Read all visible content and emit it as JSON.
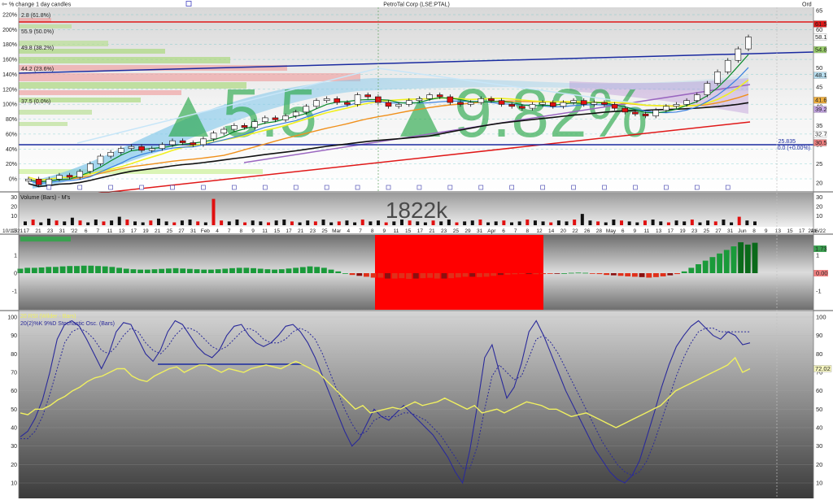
{
  "header": {
    "caption": "% change 1 day candles",
    "title": "PetroTal Corp (LSE:PTAL)",
    "right_label": "Ord",
    "big_change_left": "▲5.5",
    "big_change_right": "▲9.82%"
  },
  "colors": {
    "up_candle": "#ffffff",
    "down_candle": "#e01010",
    "ma_yellow": "#f0f020",
    "ma_orange": "#f0901c",
    "ma_black": "#101010",
    "ma_green": "#0a8a2a",
    "ma_blue": "#3a80e0",
    "trend_red": "#e01818",
    "trend_purple": "#9a66c0",
    "trend_navy": "#1a2aa0",
    "volume_up": "#101010",
    "volume_down": "#e01010",
    "macd_pos": "#1a9a3a",
    "macd_neg": "#e0301a",
    "rsi": "#f0f060",
    "stoch": "#2a2a9a"
  },
  "price_panel": {
    "left_pct_ticks": [
      "220%",
      "200%",
      "180%",
      "160%",
      "140%",
      "120%",
      "100%",
      "80%",
      "60%",
      "40%",
      "20%",
      "0%"
    ],
    "right_price_ticks": [
      "65",
      "60",
      "55",
      "50",
      "45",
      "40",
      "35",
      "30",
      "25",
      "20"
    ],
    "fib_labels": [
      "2.8 (61.8%)",
      "55.9 (50.0%)",
      "49.8 (38.2%)",
      "44.2 (23.6%)",
      "37.5 (0.0%)"
    ],
    "price_boxes": [
      {
        "label": "61.5",
        "color": "#e01818"
      },
      {
        "label": "58.1",
        "color": "#ffffff"
      },
      {
        "label": "54.8",
        "color": "#9ad06a"
      },
      {
        "label": "48.1",
        "color": "#b8dff0"
      },
      {
        "label": "41.6",
        "color": "#f0b040"
      },
      {
        "label": "39.2",
        "color": "#c8a8e8"
      },
      {
        "label": "32.7",
        "color": "#ffffff"
      },
      {
        "label": "30.5",
        "color": "#f08080"
      }
    ],
    "support_value": "25.835",
    "support_change": "0.0  (+0.00%)",
    "close_series": [
      21,
      19.5,
      21,
      22,
      21.5,
      23,
      25,
      27,
      28,
      29,
      29.5,
      28.5,
      29,
      30,
      31,
      30.5,
      30,
      31.5,
      33,
      34,
      35,
      34.5,
      36,
      37,
      36.5,
      37.5,
      38.5,
      40,
      41.5,
      42,
      41,
      40.5,
      43,
      42.5,
      41,
      40,
      40.5,
      41.5,
      42,
      43,
      42.5,
      41,
      40.5,
      41,
      42,
      41.5,
      40.5,
      40,
      39.5,
      40.5,
      41,
      40,
      41,
      41.5,
      40.5,
      41,
      40.5,
      39.5,
      38.5,
      38,
      37.5,
      39,
      40,
      40.5,
      41.5,
      43,
      46,
      49,
      52,
      55,
      58.1
    ]
  },
  "volume_panel": {
    "label": "Volume (Bars) - M's",
    "big_value": "1822k",
    "left_ticks": [
      "30",
      "20",
      "10"
    ],
    "right_ticks": [
      "30",
      "20",
      "10"
    ],
    "date_labels": [
      "10/12/21",
      "15",
      "17",
      "21",
      "23",
      "31",
      "'22",
      "6",
      "7",
      "11",
      "13",
      "17",
      "19",
      "21",
      "25",
      "27",
      "31",
      "Feb",
      "4",
      "7",
      "8",
      "9",
      "11",
      "15",
      "17",
      "21",
      "23",
      "25",
      "Mar",
      "4",
      "7",
      "8",
      "9",
      "11",
      "15",
      "17",
      "21",
      "23",
      "25",
      "29",
      "31",
      "Apr",
      "6",
      "7",
      "8",
      "12",
      "14",
      "20",
      "22",
      "26",
      "28",
      "May",
      "6",
      "9",
      "11",
      "13",
      "17",
      "19",
      "23",
      "25",
      "27",
      "31",
      "Jun",
      "8",
      "9",
      "13",
      "15",
      "17",
      "21",
      "24/6/22"
    ],
    "values": [
      4,
      6,
      3,
      7,
      5,
      4,
      8,
      5,
      3,
      6,
      4,
      5,
      9,
      6,
      4,
      3,
      5,
      7,
      4,
      3,
      5,
      6,
      4,
      3,
      28,
      5,
      4,
      6,
      3,
      5,
      4,
      3,
      5,
      6,
      4,
      3,
      5,
      4,
      6,
      3,
      4,
      5,
      3,
      6,
      4,
      5,
      3,
      4,
      6,
      5,
      4,
      3,
      5,
      4,
      6,
      3,
      4,
      5,
      6,
      3,
      4,
      5,
      3,
      4,
      6,
      5,
      4,
      3,
      5,
      4,
      6,
      12,
      5,
      4,
      3,
      6,
      5,
      4,
      3,
      5,
      6,
      4,
      3,
      5,
      4,
      6,
      3,
      5,
      4,
      6,
      3,
      9,
      5,
      4
    ]
  },
  "macd_panel": {
    "left_ticks": [
      "1",
      "0",
      "-1"
    ],
    "right_ticks": [
      "1",
      "0.00",
      "-1"
    ],
    "last_value": "1.73",
    "values": [
      0.25,
      0.3,
      0.3,
      0.32,
      0.35,
      0.35,
      0.38,
      0.4,
      0.4,
      0.42,
      0.42,
      0.4,
      0.38,
      0.35,
      0.3,
      0.25,
      0.22,
      0.2,
      0.2,
      0.22,
      0.24,
      0.26,
      0.28,
      0.26,
      0.24,
      0.22,
      0.2,
      0.2,
      0.22,
      0.25,
      0.28,
      0.3,
      0.3,
      0.28,
      0.25,
      0.22,
      0.2,
      0.22,
      0.26,
      0.3,
      0.34,
      0.38,
      0.35,
      0.3,
      0.2,
      0.1,
      0,
      -0.1,
      -0.15,
      -0.2,
      -0.25,
      -0.25,
      -0.3,
      -0.3,
      -0.28,
      -0.32,
      -0.3,
      -0.28,
      -0.26,
      -0.3,
      -0.3,
      -0.28,
      -0.24,
      -0.2,
      -0.2,
      -0.22,
      -0.2,
      -0.15,
      -0.1,
      -0.08,
      -0.06,
      -0.04,
      -0.05,
      -0.06,
      -0.05,
      -0.03,
      -0.02,
      0,
      0.02,
      0.03,
      0.02,
      -0.01,
      -0.05,
      -0.1,
      -0.12,
      -0.15,
      -0.18,
      -0.2,
      -0.22,
      -0.25,
      -0.22,
      -0.18,
      -0.12,
      -0.05,
      0.1,
      0.3,
      0.5,
      0.7,
      0.9,
      1.1,
      1.3,
      1.5,
      1.73,
      1.6,
      1.7
    ]
  },
  "osc_panel": {
    "rsi_label": "20 RSI (Wilder - Bars)",
    "stoch_label": "20(2)%K 9%D Stochastic Osc. (Bars)",
    "left_ticks": [
      "100",
      "90",
      "80",
      "70",
      "60",
      "50",
      "40",
      "30",
      "20",
      "10"
    ],
    "right_ticks": [
      "100",
      "90",
      "80",
      "70",
      "60",
      "50",
      "40",
      "30",
      "20",
      "10"
    ],
    "rsi_last": "72.02",
    "rsi": [
      48,
      47,
      50,
      50,
      52,
      55,
      57,
      60,
      62,
      65,
      67,
      68,
      70,
      72,
      72,
      68,
      66,
      65,
      68,
      70,
      72,
      73,
      70,
      72,
      74,
      74,
      72,
      70,
      72,
      71,
      70,
      72,
      73,
      74,
      73,
      72,
      74,
      76,
      74,
      72,
      70,
      66,
      62,
      58,
      54,
      50,
      52,
      48,
      49,
      50,
      51,
      50,
      52,
      54,
      52,
      53,
      54,
      56,
      54,
      52,
      50,
      52,
      48,
      49,
      50,
      48,
      50,
      52,
      54,
      53,
      52,
      50,
      50,
      48,
      46,
      47,
      48,
      46,
      44,
      42,
      40,
      42,
      44,
      46,
      48,
      50,
      52,
      56,
      60,
      62,
      64,
      66,
      68,
      70,
      72,
      74,
      78,
      70,
      72
    ],
    "stoch_k": [
      35,
      38,
      45,
      55,
      70,
      88,
      96,
      98,
      95,
      88,
      80,
      72,
      80,
      92,
      97,
      96,
      88,
      80,
      76,
      82,
      92,
      98,
      96,
      90,
      84,
      80,
      78,
      82,
      90,
      95,
      96,
      90,
      86,
      84,
      86,
      90,
      95,
      96,
      92,
      86,
      78,
      68,
      58,
      48,
      38,
      30,
      34,
      42,
      50,
      46,
      44,
      48,
      52,
      48,
      44,
      40,
      36,
      30,
      24,
      16,
      10,
      28,
      52,
      78,
      85,
      70,
      56,
      62,
      75,
      92,
      98,
      90,
      80,
      70,
      60,
      52,
      44,
      36,
      28,
      22,
      16,
      12,
      10,
      14,
      22,
      35,
      48,
      62,
      74,
      84,
      90,
      95,
      98,
      94,
      90,
      88,
      92,
      90,
      85,
      86
    ],
    "stoch_d": [
      34,
      34,
      38,
      46,
      58,
      72,
      86,
      92,
      94,
      92,
      88,
      82,
      80,
      84,
      90,
      94,
      92,
      86,
      82,
      80,
      84,
      90,
      94,
      94,
      92,
      88,
      84,
      82,
      84,
      88,
      92,
      94,
      92,
      88,
      86,
      86,
      88,
      92,
      94,
      92,
      88,
      80,
      70,
      60,
      50,
      42,
      36,
      38,
      44,
      46,
      46,
      46,
      48,
      48,
      46,
      44,
      40,
      36,
      30,
      24,
      18,
      18,
      30,
      50,
      68,
      74,
      70,
      66,
      68,
      78,
      88,
      90,
      86,
      80,
      72,
      64,
      56,
      48,
      40,
      32,
      26,
      20,
      16,
      14,
      16,
      22,
      32,
      44,
      56,
      68,
      78,
      86,
      92,
      94,
      94,
      92,
      92,
      92,
      92,
      92
    ]
  }
}
